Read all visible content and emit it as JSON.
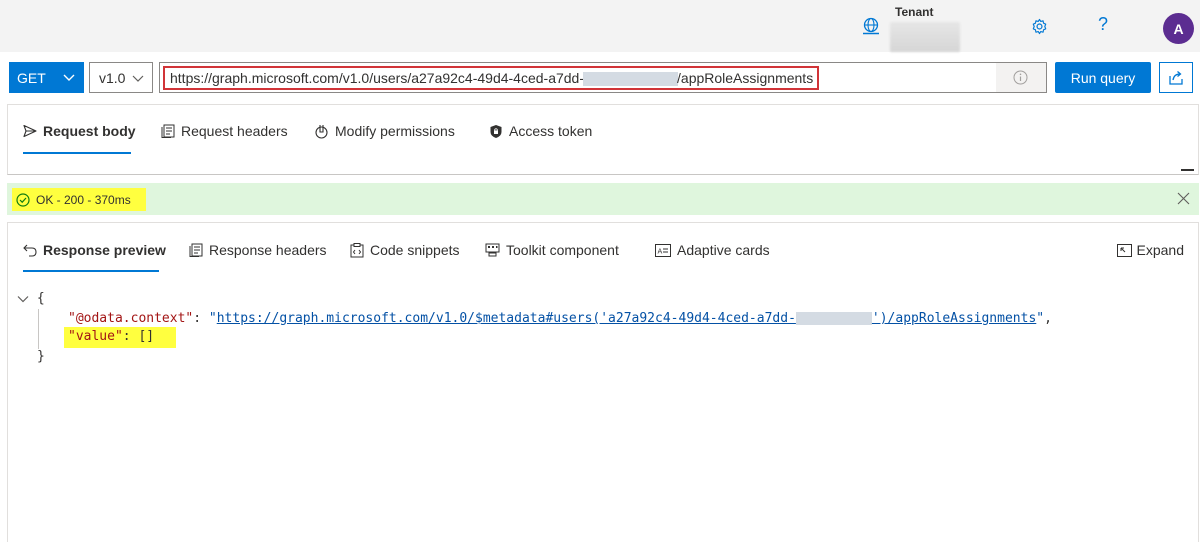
{
  "header": {
    "tenant_label": "Tenant",
    "help_glyph": "?",
    "avatar_initial": "A",
    "icons": [
      "tenant-globe-icon",
      "gear-icon",
      "help-icon"
    ]
  },
  "query": {
    "method": "GET",
    "version": "v1.0",
    "url_prefix": "https://graph.microsoft.com/v1.0/users/a27a92c4-49d4-4ced-a7dd-",
    "url_suffix": "/appRoleAssignments",
    "run_label": "Run query"
  },
  "request_tabs": [
    {
      "label": "Request body",
      "icon": "send-icon"
    },
    {
      "label": "Request headers",
      "icon": "headers-icon"
    },
    {
      "label": "Modify permissions",
      "icon": "permissions-icon"
    },
    {
      "label": "Access token",
      "icon": "shield-lock-icon"
    }
  ],
  "status": {
    "text": "OK - 200 - 370ms",
    "color": "#107c10",
    "highlight": "#ffff3f"
  },
  "response_tabs": [
    {
      "label": "Response preview",
      "icon": "back-arrow-icon"
    },
    {
      "label": "Response headers",
      "icon": "headers-icon"
    },
    {
      "label": "Code snippets",
      "icon": "snippet-icon"
    },
    {
      "label": "Toolkit component",
      "icon": "toolkit-icon"
    },
    {
      "label": "Adaptive cards",
      "icon": "card-icon"
    }
  ],
  "expand_label": "Expand",
  "response": {
    "open_brace": "{",
    "close_brace": "}",
    "context_key": "\"@odata.context\"",
    "colon": ": ",
    "context_value_open": "\"",
    "context_value_prefix": "https://graph.microsoft.com/v1.0/$metadata#users('a27a92c4-49d4-4ced-a7dd-",
    "context_value_suffix": "')/appRoleAssignments",
    "context_value_close": "\"",
    "comma": ",",
    "value_key": "\"value\"",
    "value_value": "[]"
  },
  "colors": {
    "accent": "#0078d4",
    "status_bg": "#dff6dd",
    "url_highlight": "#d13438",
    "avatar": "#5c2d91"
  }
}
